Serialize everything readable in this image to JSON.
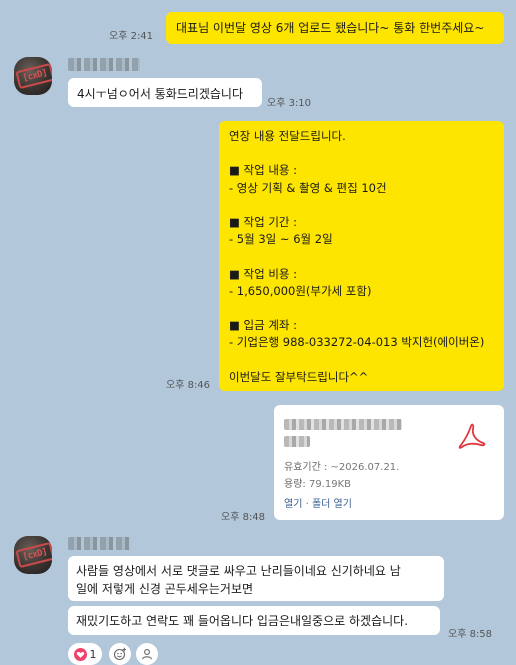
{
  "messages": {
    "m1": {
      "text": "대표님 이번달 영상 6개 업로드 됐습니다~ 통화 한번주세요~",
      "time": "오후 2:41"
    },
    "m2": {
      "text": "4시ㅜ넘ㅇ어서 통화드리겠습니다",
      "time": "오후 3:10"
    },
    "m3": {
      "text": "연장 내용 전달드립니다.\n\n■ 작업 내용 :\n- 영상 기획 & 촬영 & 편집 10건\n\n■ 작업 기간 :\n- 5월 3일 ~ 6월 2일\n\n■ 작업 비용 :\n- 1,650,000원(부가세 포함)\n\n■ 입금 계좌 :\n- 기업은행 988-033272-04-013 박지헌(에이버온)\n\n이번달도 잘부탁드립니다^^",
      "time": "오후 8:46"
    },
    "m4": {
      "validity_label": "유효기간 : ",
      "validity_value": "~2026.07.21.",
      "size_label": "용량: ",
      "size_value": "79.19KB",
      "open_label": "열기",
      "separator": " · ",
      "folder_label": "폴더 열기",
      "time": "오후 8:48",
      "icon": "pdf-icon"
    },
    "m5": {
      "text": "사람들 영상에서 서로 댓글로 싸우고 난리들이네요 신기하네요 남\n일에 저렇게 신경 곤두세우는거보면"
    },
    "m6": {
      "text": "재밌기도하고 연락도 꽤 들어옵니다 입금은내일중으로 하겠습니다.",
      "time": "오후 8:58"
    }
  },
  "avatar": {
    "logo_text": "[cxD]"
  },
  "reactions": {
    "heart_count": "1"
  },
  "colors": {
    "background": "#b2c7da",
    "my_bubble": "#fee500",
    "other_bubble": "#ffffff",
    "link": "#3a5f93",
    "pdf_red": "#e0383e",
    "heart": "#f0436b"
  }
}
